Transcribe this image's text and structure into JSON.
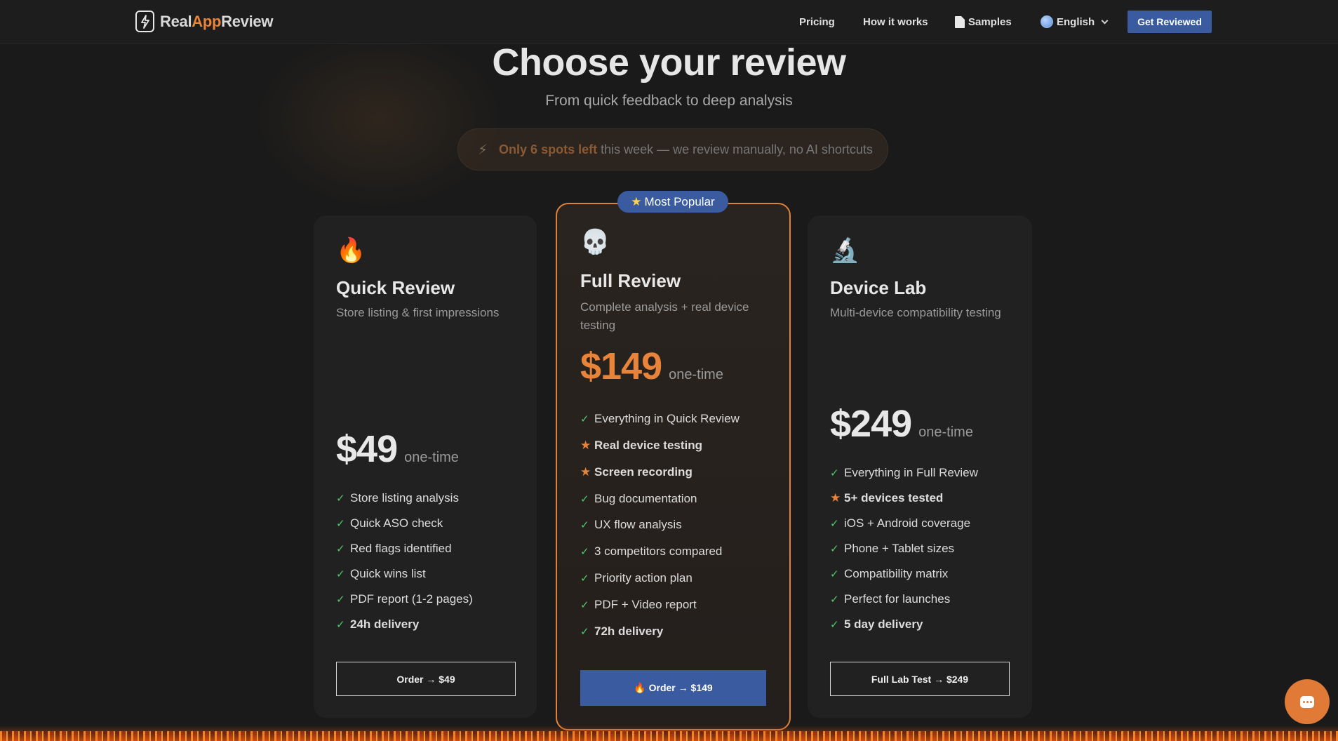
{
  "header": {
    "logo": {
      "part1": "Real",
      "part2": "App",
      "part3": "Review"
    },
    "nav": {
      "pricing": "Pricing",
      "how": "How it works",
      "samples": "Samples",
      "language": "English"
    },
    "cta": "Get Reviewed"
  },
  "hero": {
    "title": "Choose your review",
    "subtitle": "From quick feedback to deep analysis",
    "spots_highlight": "Only 6 spots left",
    "spots_rest": "this week — we review manually, no AI shortcuts"
  },
  "cards": [
    {
      "emoji": "🔥",
      "title": "Quick Review",
      "desc": "Store listing & first impressions",
      "price": "$49",
      "per": "one-time",
      "features": [
        {
          "mark": "✓",
          "text": "Store listing analysis"
        },
        {
          "mark": "✓",
          "text": "Quick ASO check"
        },
        {
          "mark": "✓",
          "text": "Red flags identified"
        },
        {
          "mark": "✓",
          "text": "Quick wins list"
        },
        {
          "mark": "✓",
          "text": "PDF report (1-2 pages)"
        },
        {
          "mark": "✓",
          "text": "24h delivery"
        }
      ],
      "button": "Order → $49"
    },
    {
      "badge": "Most Popular",
      "emoji": "💀",
      "title": "Full Review",
      "desc": "Complete analysis + real device testing",
      "price": "$149",
      "per": "one-time",
      "features": [
        {
          "mark": "✓",
          "text": "Everything in Quick Review"
        },
        {
          "mark": "★",
          "text": "Real device testing"
        },
        {
          "mark": "★",
          "text": "Screen recording"
        },
        {
          "mark": "✓",
          "text": "Bug documentation"
        },
        {
          "mark": "✓",
          "text": "UX flow analysis"
        },
        {
          "mark": "✓",
          "text": "3 competitors compared"
        },
        {
          "mark": "✓",
          "text": "Priority action plan"
        },
        {
          "mark": "✓",
          "text": "PDF + Video report"
        },
        {
          "mark": "✓",
          "text": "72h delivery"
        }
      ],
      "button": "🔥 Order → $149"
    },
    {
      "emoji": "🔬",
      "title": "Device Lab",
      "desc": "Multi-device compatibility testing",
      "price": "$249",
      "per": "one-time",
      "features": [
        {
          "mark": "✓",
          "text": "Everything in Full Review"
        },
        {
          "mark": "★",
          "text": "5+ devices tested"
        },
        {
          "mark": "✓",
          "text": "iOS + Android coverage"
        },
        {
          "mark": "✓",
          "text": "Phone + Tablet sizes"
        },
        {
          "mark": "✓",
          "text": "Compatibility matrix"
        },
        {
          "mark": "✓",
          "text": "Perfect for launches"
        },
        {
          "mark": "✓",
          "text": "5 day delivery"
        }
      ],
      "button": "Full Lab Test → $249"
    }
  ],
  "icons": {
    "logo": "bolt-icon",
    "samples": "document-icon",
    "language": "globe-icon",
    "chat": "chat-icon"
  },
  "colors": {
    "accent_orange": "#e8843a",
    "primary_blue": "#3a5ba0",
    "check_green": "#4ec96a",
    "background": "#1a1a1a"
  }
}
